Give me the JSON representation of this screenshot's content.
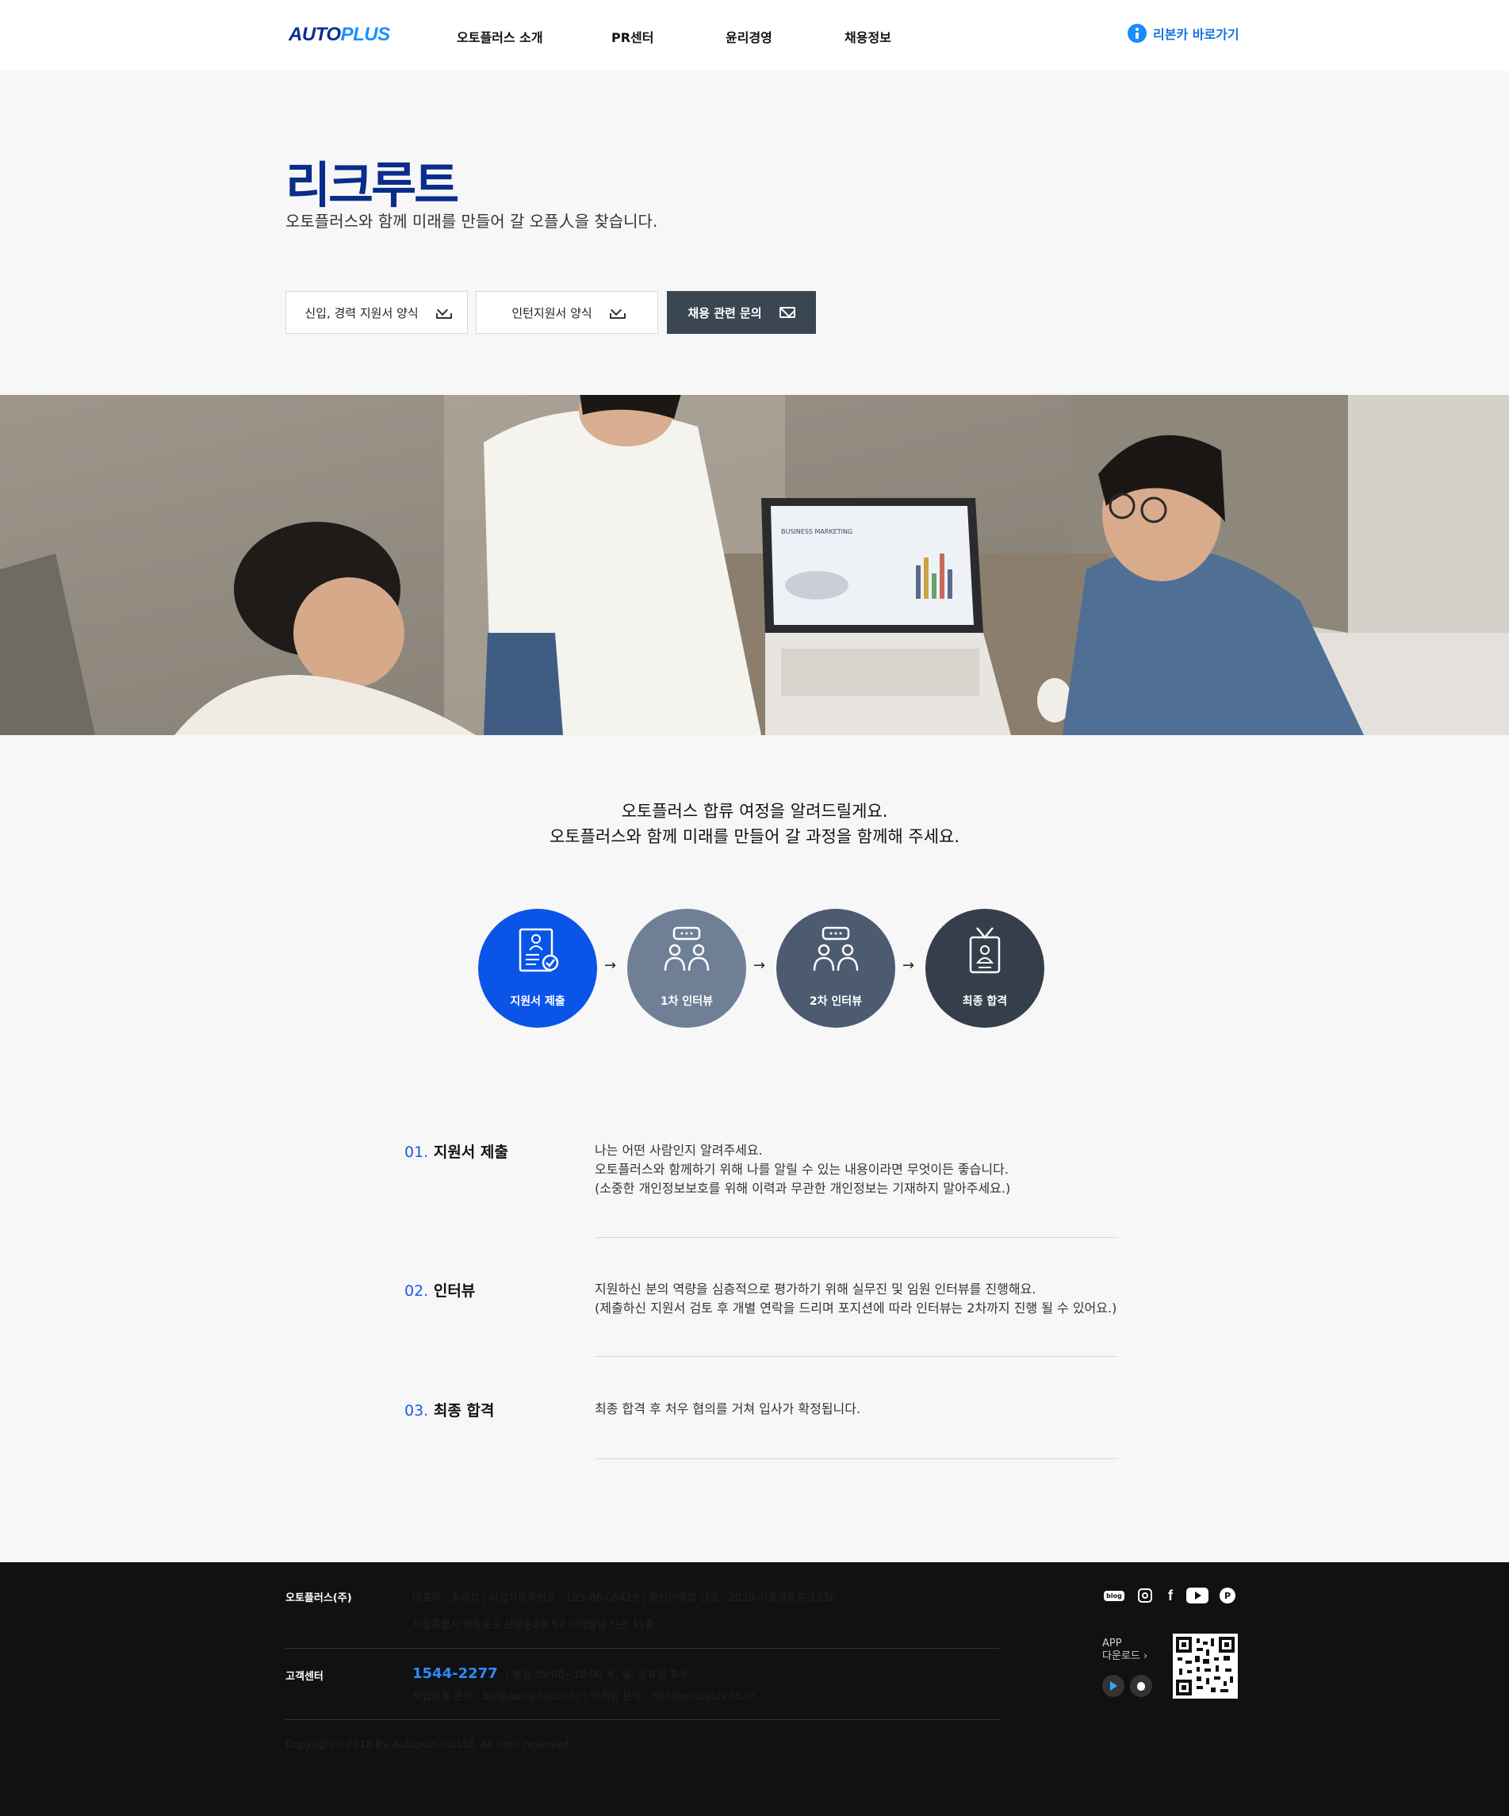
{
  "header": {
    "logo_part1": "AUTO",
    "logo_part2": "PLUS",
    "nav": [
      "오토플러스 소개",
      "PR센터",
      "윤리경영",
      "채용정보"
    ],
    "reborn_link": "리본카 바로가기"
  },
  "hero": {
    "title": "리크루트",
    "subtitle": "오토플러스와 함께 미래를 만들어 갈 오플人을 찾습니다.",
    "buttons": {
      "newcomer_form": "신입, 경력 지원서 양식",
      "intern_form": "인턴지원서 양식",
      "contact": "채용 관련 문의"
    }
  },
  "photo": {
    "laptop_text": "BUSINESS MARKETING"
  },
  "journey": {
    "intro_line1": "오토플러스 합류 여정을 알려드릴게요.",
    "intro_line2": "오토플러스와 함께 미래를 만들어 갈 과정을 함께해 주세요.",
    "steps": [
      {
        "label": "지원서 제출",
        "color": "#0a55e8"
      },
      {
        "label": "1차 인터뷰",
        "color": "#6f7f96"
      },
      {
        "label": "2차 인터뷰",
        "color": "#4d5b70"
      },
      {
        "label": "최종 합격",
        "color": "#353f4c"
      }
    ],
    "arrow": "→"
  },
  "details": [
    {
      "num": "01.",
      "title": "지원서 제출",
      "lines": [
        "나는 어떤 사람인지 알려주세요.",
        "오토플러스와 함께하기 위해 나를 알릴 수 있는 내용이라면 무엇이든 좋습니다.",
        "(소중한 개인정보보호를 위해 이력과 무관한 개인정보는 기재하지 말아주세요.)"
      ]
    },
    {
      "num": "02.",
      "title": "인터뷰",
      "lines": [
        "지원하신 분의 역량을 심층적으로 평가하기 위해 실무진 및 임원 인터뷰를 진행해요.",
        "(제출하신 지원서 검토 후 개별 연락을 드리며 포지션에 따라 인터뷰는 2차까지 진행 될 수 있어요.)"
      ]
    },
    {
      "num": "03.",
      "title": "최종 합격",
      "lines": [
        "최종 합격 후 처우 협의를 거쳐 입사가 확정됩니다."
      ]
    }
  ],
  "footer": {
    "company": "오토플러스(주)",
    "info_line1": "대표자 : 송재성   |   사업자등록번호 : 105-86-06429   |   통신판매업 신고 : 2020-서울영등포-1338",
    "info_line2": "서울특별시 영등포구 선유동2로 57 이레빌딩 신관 11층",
    "cs_label": "고객센터",
    "phone": "1544-2277",
    "hours": "|   평일 09:00~18:00 토, 일, 공휴일 휴무",
    "contact_line": "사업제휴 문의 : biz@autoplus.co.kr   |   마케팅 문의 : mkt@autoplus.co.kr",
    "copyright": "Copyright©2018 By Autoplus.Co.Ltd. All right reserved.",
    "app_label1": "APP",
    "app_label2": "다운로드",
    "app_chevron": "›",
    "sns": [
      "blog-icon",
      "instagram-icon",
      "facebook-icon",
      "youtube-icon",
      "post-icon"
    ],
    "sns_glyphs": {
      "blog": "blog",
      "facebook": "f",
      "post": "P"
    }
  }
}
